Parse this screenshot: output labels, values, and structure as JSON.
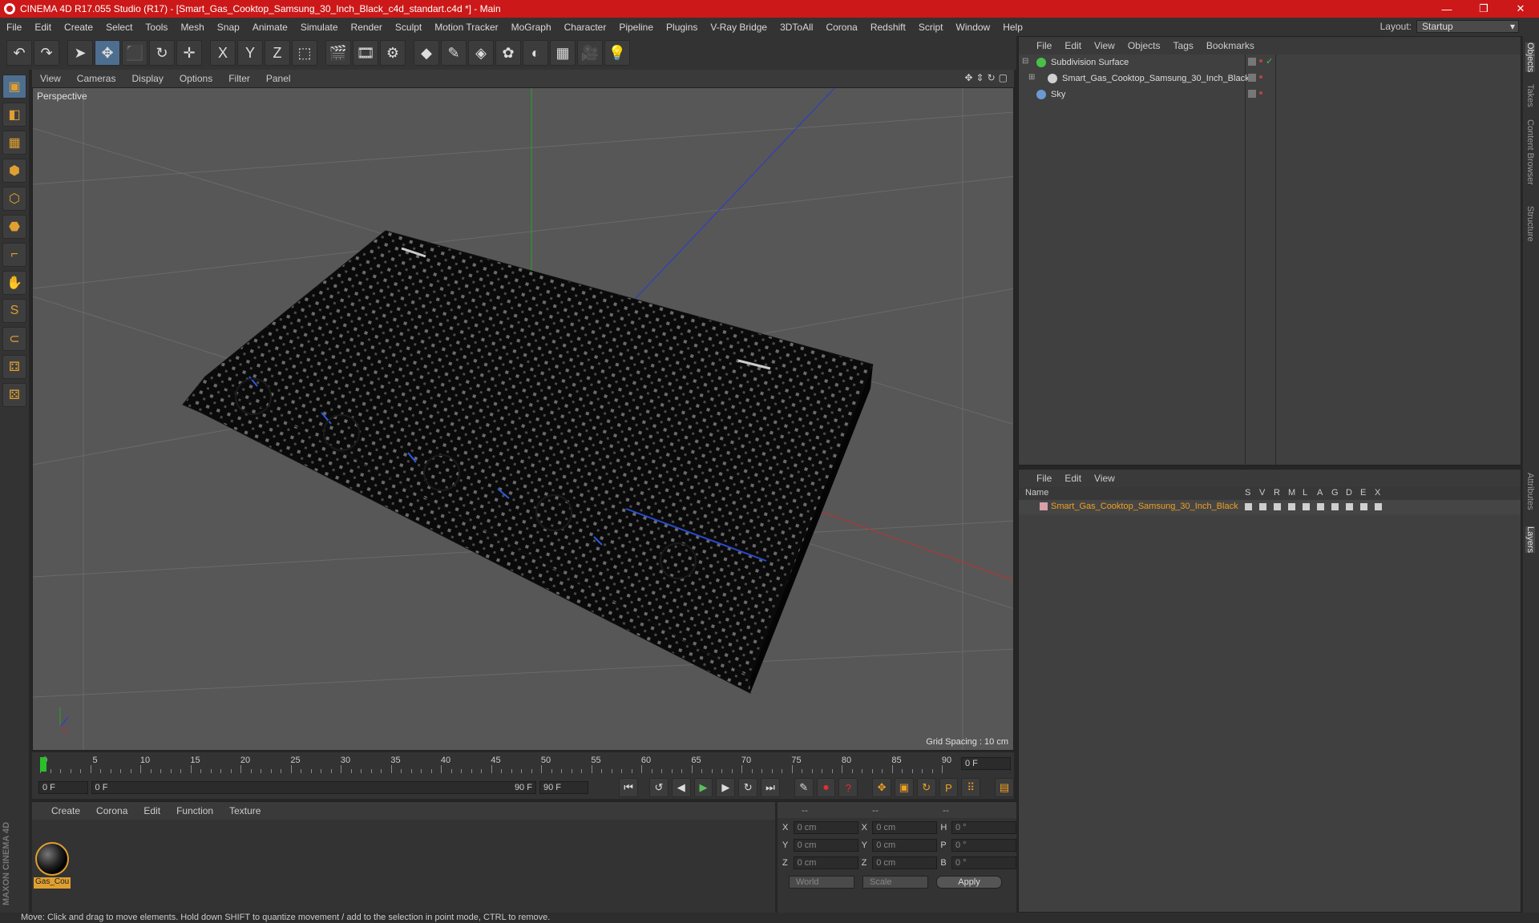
{
  "window": {
    "title": "CINEMA 4D R17.055 Studio (R17) - [Smart_Gas_Cooktop_Samsung_30_Inch_Black_c4d_standart.c4d *] - Main",
    "controls": [
      "—",
      "❐",
      "✕"
    ]
  },
  "menubar": {
    "items": [
      "File",
      "Edit",
      "Create",
      "Select",
      "Tools",
      "Mesh",
      "Snap",
      "Animate",
      "Simulate",
      "Render",
      "Sculpt",
      "Motion Tracker",
      "MoGraph",
      "Character",
      "Pipeline",
      "Plugins",
      "V-Ray Bridge",
      "3DToAll",
      "Corona",
      "Redshift",
      "Script",
      "Window",
      "Help"
    ],
    "layout_label": "Layout:",
    "layout_value": "Startup"
  },
  "toolbar": {
    "icons": [
      "undo-icon",
      "redo-icon",
      "select-arrow-icon",
      "move-icon",
      "scale-icon",
      "rotate-icon",
      "last-tool-icon",
      "x-axis-icon",
      "y-axis-icon",
      "z-axis-icon",
      "coordinate-system-icon",
      "render-view-icon",
      "render-picture-viewer-icon",
      "render-settings-icon",
      "cube-icon",
      "pen-spline-icon",
      "subdivision-icon",
      "mograph-cloner-icon",
      "deformer-icon",
      "floor-icon",
      "camera-icon",
      "light-icon"
    ],
    "glyphs": [
      "↶",
      "↷",
      "➤",
      "✥",
      "⬛",
      "↻",
      "✛",
      "X",
      "Y",
      "Z",
      "⬚",
      "🎬",
      "🎞",
      "⚙",
      "◆",
      "✎",
      "◈",
      "✿",
      "◐",
      "▦",
      "🎥",
      "💡"
    ]
  },
  "lefttools": {
    "icons": [
      "model-mode-icon",
      "texture-mode-icon",
      "workplane-icon",
      "points-mode-icon",
      "edges-mode-icon",
      "polygons-mode-icon",
      "axis-icon",
      "tweak-icon",
      "snap-icon",
      "magnet-icon",
      "lock-grid-icon",
      "soft-selection-icon"
    ],
    "glyphs": [
      "▣",
      "◧",
      "▦",
      "⬢",
      "⬡",
      "⬣",
      "⌐",
      "✋",
      "S",
      "⊂",
      "⚃",
      "⚄"
    ]
  },
  "viewport": {
    "menu": [
      "View",
      "Cameras",
      "Display",
      "Options",
      "Filter",
      "Panel"
    ],
    "label": "Perspective",
    "grid_spacing": "Grid Spacing : 10 cm"
  },
  "timeline": {
    "ticks": [
      "0",
      "5",
      "10",
      "15",
      "20",
      "25",
      "30",
      "35",
      "40",
      "45",
      "50",
      "55",
      "60",
      "65",
      "70",
      "75",
      "80",
      "85",
      "90"
    ],
    "current_frame": "0 F",
    "start_field": "0 F",
    "range_start": "0 F",
    "range_end": "90 F",
    "end_field": "90 F"
  },
  "material_manager": {
    "menu": [
      "Create",
      "Corona",
      "Edit",
      "Function",
      "Texture"
    ],
    "material_name": "Gas_Cou"
  },
  "coordinates": {
    "header": [
      "--",
      "--",
      "--"
    ],
    "rows": [
      {
        "a1": "X",
        "v1": "0 cm",
        "a2": "X",
        "v2": "0 cm",
        "a3": "H",
        "v3": "0 °"
      },
      {
        "a1": "Y",
        "v1": "0 cm",
        "a2": "Y",
        "v2": "0 cm",
        "a3": "P",
        "v3": "0 °"
      },
      {
        "a1": "Z",
        "v1": "0 cm",
        "a2": "Z",
        "v2": "0 cm",
        "a3": "B",
        "v3": "0 °"
      }
    ],
    "space": "World",
    "mode": "Scale",
    "apply": "Apply"
  },
  "object_manager": {
    "menu": [
      "File",
      "Edit",
      "View",
      "Objects",
      "Tags",
      "Bookmarks"
    ],
    "objects": [
      {
        "name": "Subdivision Surface",
        "color": "#4ac04a"
      },
      {
        "name": "Smart_Gas_Cooktop_Samsung_30_Inch_Black",
        "color": "#d0d0d0"
      },
      {
        "name": "Sky",
        "color": "#6a9ad0"
      }
    ]
  },
  "layer_manager": {
    "menu": [
      "File",
      "Edit",
      "View"
    ],
    "columns": [
      "Name",
      "S",
      "V",
      "R",
      "M",
      "L",
      "A",
      "G",
      "D",
      "E",
      "X"
    ],
    "layer_name": "Smart_Gas_Cooktop_Samsung_30_Inch_Black"
  },
  "right_tabs": [
    "Objects",
    "Takes",
    "Content Browser",
    "Structure",
    "Attributes",
    "Layers"
  ],
  "maxon": "MAXON CINEMA 4D",
  "status": "Move: Click and drag to move elements. Hold down SHIFT to quantize movement / add to the selection in point mode, CTRL to remove.",
  "colors": {
    "title_bar": "#cc1818",
    "accent": "#e0a030",
    "active_tool": "#4e6e90"
  }
}
